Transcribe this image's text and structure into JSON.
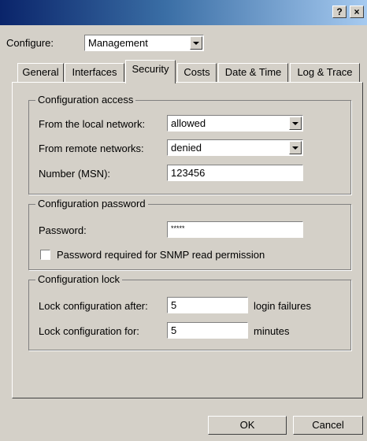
{
  "titlebar": {
    "help_label": "?",
    "close_label": "×"
  },
  "configure": {
    "label": "Configure:",
    "value": "Management"
  },
  "tabs": [
    {
      "label": "General"
    },
    {
      "label": "Interfaces"
    },
    {
      "label": "Security"
    },
    {
      "label": "Costs"
    },
    {
      "label": "Date & Time"
    },
    {
      "label": "Log & Trace"
    }
  ],
  "config_access": {
    "legend": "Configuration access",
    "local_label": "From the local network:",
    "local_value": "allowed",
    "remote_label": "From remote networks:",
    "remote_value": "denied",
    "msn_label": "Number (MSN):",
    "msn_value": "123456"
  },
  "config_password": {
    "legend": "Configuration password",
    "password_label": "Password:",
    "password_value": "*****",
    "snmp_label": "Password required for SNMP read permission"
  },
  "config_lock": {
    "legend": "Configuration lock",
    "after_label": "Lock configuration after:",
    "after_value": "5",
    "after_unit": "login failures",
    "for_label": "Lock configuration for:",
    "for_value": "5",
    "for_unit": "minutes"
  },
  "buttons": {
    "ok": "OK",
    "cancel": "Cancel"
  }
}
